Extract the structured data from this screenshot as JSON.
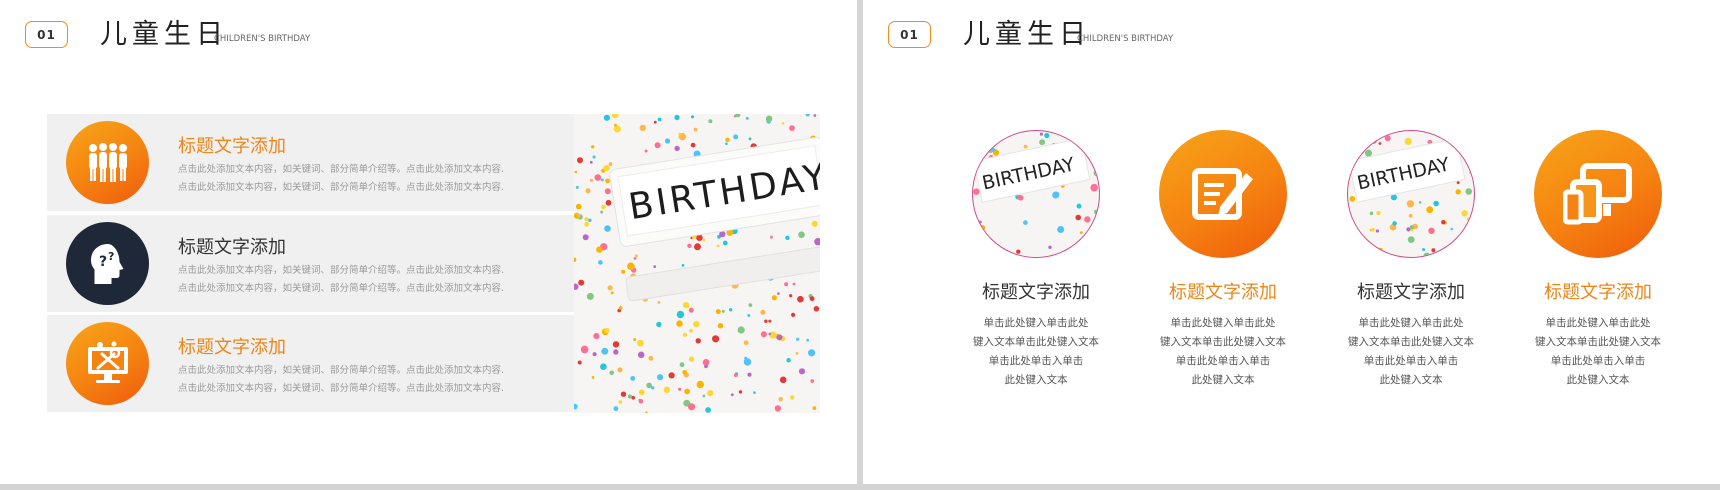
{
  "header": {
    "badge": "01",
    "title": "儿童生日",
    "subtitle": "CHILDREN'S BIRTHDAY"
  },
  "left_slide": {
    "rows": [
      {
        "icon": "people-icon",
        "title": "标题文字添加",
        "title_color": "#ec8617",
        "line1": "点击此处添加文本内容，如关键词、部分简单介绍等。点击此处添加文本内容.",
        "line2": "点击此处添加文本内容，如关键词、部分简单介绍等。点击此处添加文本内容."
      },
      {
        "icon": "head-question-icon",
        "title": "标题文字添加",
        "title_color": "#333333",
        "line1": "点击此处添加文本内容，如关键词、部分简单介绍等。点击此处添加文本内容.",
        "line2": "点击此处添加文本内容，如关键词、部分简单介绍等。点击此处添加文本内容."
      },
      {
        "icon": "monitor-tools-icon",
        "title": "标题文字添加",
        "title_color": "#ec8617",
        "line1": "点击此处添加文本内容，如关键词、部分简单介绍等。点击此处添加文本内容.",
        "line2": "点击此处添加文本内容，如关键词、部分简单介绍等。点击此处添加文本内容."
      }
    ],
    "photo": {
      "sign_text": "BIRTHDAY"
    }
  },
  "right_slide": {
    "columns": [
      {
        "kind": "photo",
        "sign_text": "BIRTHDAY",
        "title": "标题文字添加",
        "title_color": "#333333",
        "lines": [
          "单击此处键入单击此处",
          "键入文本单击此处键入文本",
          "单击此处单击入单击",
          "此处键入文本"
        ]
      },
      {
        "kind": "icon",
        "icon": "edit-document-icon",
        "title": "标题文字添加",
        "title_color": "#ec8617",
        "lines": [
          "单击此处键入单击此处",
          "键入文本单击此处键入文本",
          "单击此处单击入单击",
          "此处键入文本"
        ]
      },
      {
        "kind": "photo",
        "sign_text": "BIRTHDAY",
        "title": "标题文字添加",
        "title_color": "#333333",
        "lines": [
          "单击此处键入单击此处",
          "键入文本单击此处键入文本",
          "单击此处单击入单击",
          "此处键入文本"
        ]
      },
      {
        "kind": "icon",
        "icon": "devices-icon",
        "title": "标题文字添加",
        "title_color": "#ec8617",
        "lines": [
          "单击此处键入单击此处",
          "键入文本单击此处键入文本",
          "单击此处单击入单击",
          "此处键入文本"
        ]
      }
    ]
  },
  "colors": {
    "accent_orange": "#f58211",
    "accent_dark": "#1f2838",
    "row_background": "#f0f0f0"
  }
}
